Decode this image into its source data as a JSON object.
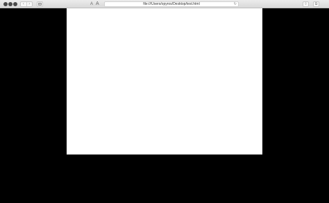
{
  "toolbar": {
    "address": "file:///Users/opyros/Desktop/test.html",
    "font_small_label": "A",
    "font_large_label": "A"
  },
  "icons": {
    "back": "chevron-left-icon",
    "forward": "chevron-right-icon",
    "sidebar": "sidebar-icon",
    "reload": "reload-icon",
    "share": "share-icon",
    "tabs": "tabs-overview-icon"
  },
  "colors": {
    "page_background": "#000000",
    "document_background": "#ffffff",
    "toolbar_background": "#e4e4e4"
  }
}
